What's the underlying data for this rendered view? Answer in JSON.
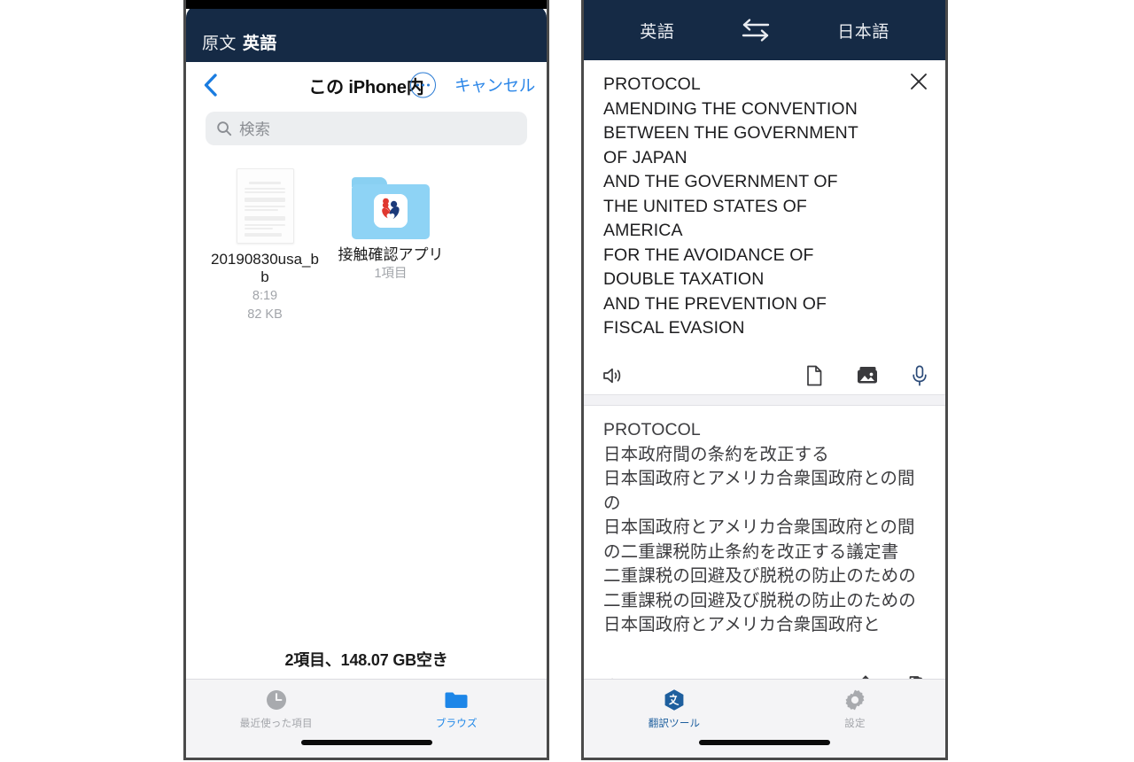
{
  "left_phone": {
    "status_bar": {
      "source_label": "原文",
      "language": "英語"
    },
    "nav_bar": {
      "back_icon": "chevron-left-icon",
      "title": "この iPhone内",
      "more_icon": "ellipsis-circle-icon",
      "cancel_label": "キャンセル"
    },
    "search": {
      "icon": "search-icon",
      "placeholder": "検索",
      "value": ""
    },
    "files": [
      {
        "name": "20190830usa_bb",
        "meta_line_1": "8:19",
        "meta_line_2": "82 KB",
        "icon": "document-thumbnail-icon",
        "type": "document"
      },
      {
        "name": "接触確認アプリ",
        "meta_line_1": "1項目",
        "meta_line_2": "",
        "icon": "folder-icon",
        "type": "folder"
      }
    ],
    "footer_status": "2項目、148.07 GB空き",
    "tabs": [
      {
        "label": "最近使った項目",
        "icon": "clock-icon",
        "active": false
      },
      {
        "label": "ブラウズ",
        "icon": "folder-icon",
        "active": true
      }
    ]
  },
  "right_phone": {
    "status_bar": {
      "source_language": "英語",
      "swap_icon": "swap-arrows-icon",
      "target_language": "日本語"
    },
    "source_pane": {
      "close_icon": "close-icon",
      "text": "PROTOCOL\nAMENDING THE CONVENTION\nBETWEEN THE GOVERNMENT\nOF JAPAN\nAND THE GOVERNMENT OF\nTHE UNITED STATES OF\nAMERICA\nFOR THE AVOIDANCE OF\nDOUBLE TAXATION\nAND THE PREVENTION OF\nFISCAL EVASION",
      "toolbar": [
        {
          "icon": "speaker-icon",
          "position": "left"
        },
        {
          "icon": "document-icon",
          "position": "right"
        },
        {
          "icon": "photos-icon",
          "position": "right"
        },
        {
          "icon": "microphone-icon",
          "position": "right"
        }
      ]
    },
    "target_pane": {
      "text": "PROTOCOL\n日本政府間の条約を改正する\n日本国政府とアメリカ合衆国政府との間の\n日本国政府とアメリカ合衆国政府との間の二重課税防止条約を改正する議定書\n二重課税の回避及び脱税の防止のための\n二重課税の回避及び脱税の防止のための日本国政府とアメリカ合衆国政府と",
      "toolbar": [
        {
          "icon": "speaker-icon",
          "position": "left"
        },
        {
          "icon": "share-icon",
          "position": "right"
        },
        {
          "icon": "copy-icon",
          "position": "right"
        }
      ]
    },
    "tabs": [
      {
        "label": "翻訳ツール",
        "icon": "translate-tool-icon",
        "active": true
      },
      {
        "label": "設定",
        "icon": "gear-icon",
        "active": false
      }
    ]
  },
  "colors": {
    "navy": "#152a45",
    "ios_blue": "#2b86e8",
    "folder_blue": "#8ed3f5",
    "tab_blue": "#1d86e8",
    "tab_navy": "#1e5f9e",
    "gray_text": "#a2a5aa"
  }
}
